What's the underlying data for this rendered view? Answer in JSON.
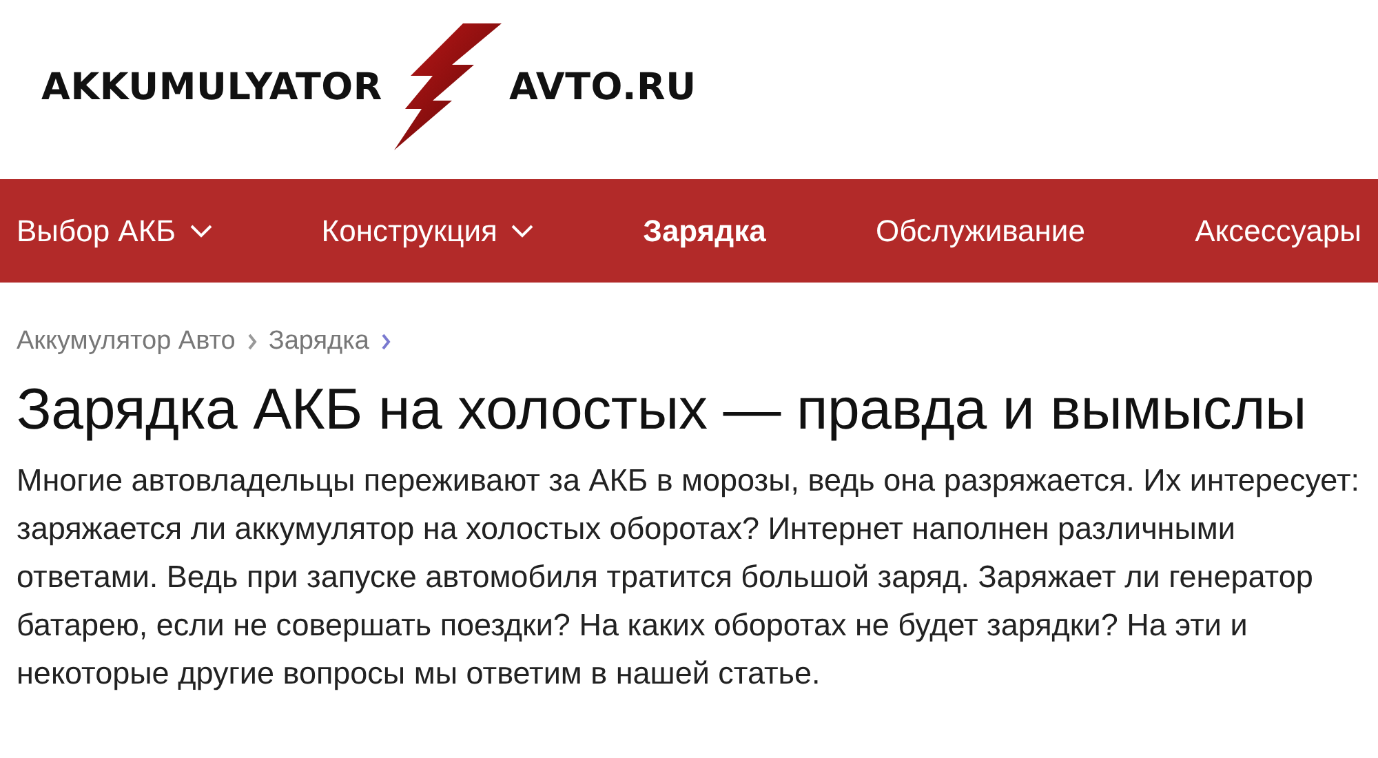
{
  "logo": {
    "left": "AKKUMULYATOR",
    "right": "AVTO.RU"
  },
  "nav": [
    {
      "label": "Выбор АКБ",
      "selected": false,
      "dropdown": true
    },
    {
      "label": "Конструкция",
      "selected": false,
      "dropdown": true
    },
    {
      "label": "Зарядка",
      "selected": true,
      "dropdown": false
    },
    {
      "label": "Обслуживание",
      "selected": false,
      "dropdown": false
    },
    {
      "label": "Аксессуары",
      "selected": false,
      "dropdown": false
    }
  ],
  "breadcrumbs": [
    {
      "label": "Аккумулятор Авто"
    },
    {
      "label": "Зарядка"
    }
  ],
  "article": {
    "title": "Зарядка АКБ на холостых — правда и вымыслы",
    "intro": "Многие автовладельцы переживают за АКБ в морозы, ведь она разряжается. Их интересует: заряжается ли аккумулятор на холостых оборотах? Интернет наполнен различными ответами. Ведь при запуске автомобиля тратится большой заряд. Заряжает ли генератор батарею, если не совершать поездки? На каких оборотах не будет зарядки? На эти и некоторые другие вопросы мы ответим в нашей статье."
  }
}
